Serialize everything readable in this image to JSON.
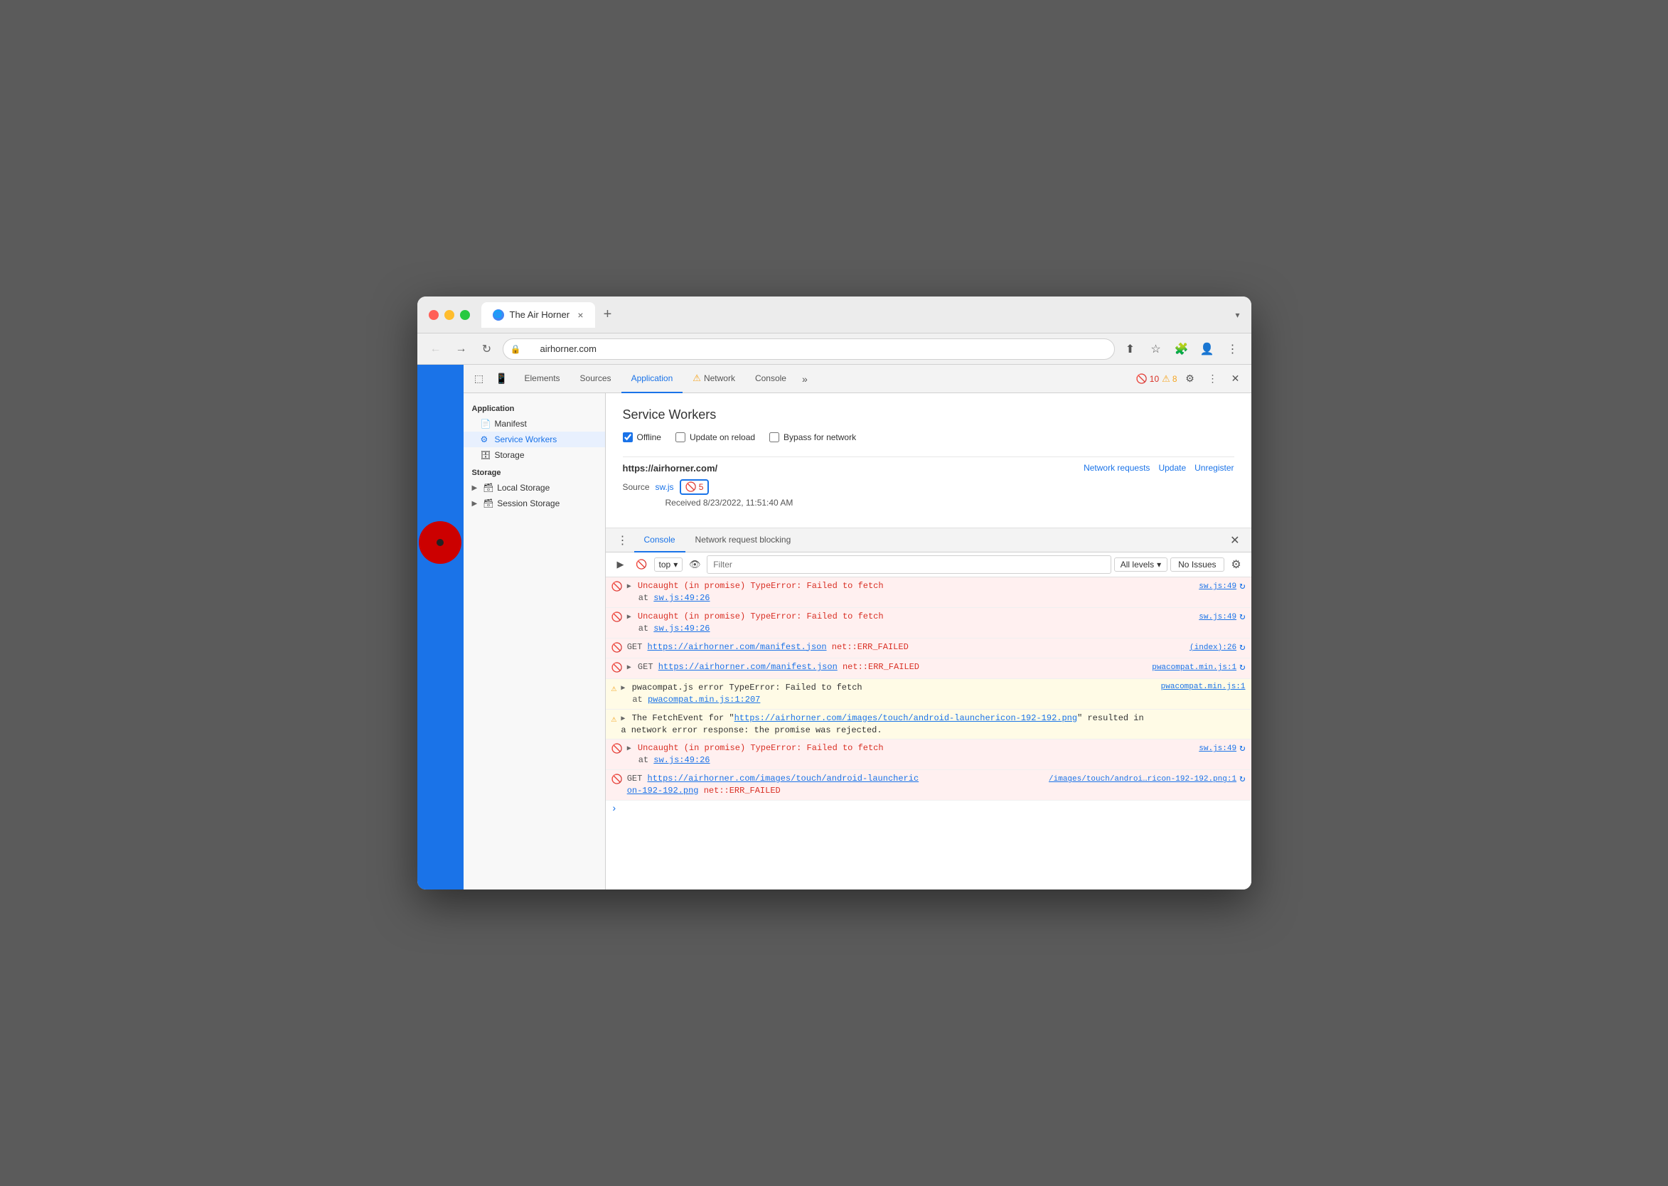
{
  "browser": {
    "tab_title": "The Air Horner",
    "url": "airhorner.com",
    "new_tab_label": "+"
  },
  "address_bar": {
    "back_btn": "←",
    "forward_btn": "→",
    "reload_btn": "↻"
  },
  "devtools": {
    "tabs": [
      {
        "id": "elements",
        "label": "Elements"
      },
      {
        "id": "sources",
        "label": "Sources"
      },
      {
        "id": "application",
        "label": "Application",
        "active": true
      },
      {
        "id": "network",
        "label": "Network",
        "warning": true
      },
      {
        "id": "console",
        "label": "Console"
      }
    ],
    "more_tabs_label": "»",
    "error_count": "10",
    "warn_count": "8"
  },
  "sidebar": {
    "section_application": "Application",
    "manifest": "Manifest",
    "service_workers": "Service Workers",
    "storage": "Storage",
    "section_storage": "Storage",
    "local_storage": "Local Storage",
    "session_storage": "Session Storage"
  },
  "sw_panel": {
    "title": "Service Workers",
    "offline_label": "Offline",
    "update_on_reload_label": "Update on reload",
    "bypass_for_network_label": "Bypass for network",
    "entry_url": "https://airhorner.com/",
    "network_requests_label": "Network requests",
    "update_label": "Update",
    "unregister_label": "Unregister",
    "source_label": "Source",
    "source_file": "sw.js",
    "error_count": "5",
    "received_label": "Received 8/23/2022, 11:51:40 AM"
  },
  "console_tabs": {
    "tab1": "Console",
    "tab2": "Network request blocking"
  },
  "console_toolbar": {
    "context": "top",
    "filter_placeholder": "Filter",
    "level": "All levels",
    "no_issues": "No Issues"
  },
  "console_messages": [
    {
      "type": "error",
      "expand": true,
      "main": "Uncaught (in promise) TypeError: Failed to fetch",
      "sub": "at sw.js:49:26",
      "source": "sw.js:49"
    },
    {
      "type": "error",
      "expand": true,
      "main": "Uncaught (in promise) TypeError: Failed to fetch",
      "sub": "at sw.js:49:26",
      "source": "sw.js:49"
    },
    {
      "type": "error",
      "expand": false,
      "main": "GET https://airhorner.com/manifest.json net::ERR_FAILED",
      "sub": "",
      "source": "(index):26"
    },
    {
      "type": "error",
      "expand": true,
      "main": "GET https://airhorner.com/manifest.json net::ERR_FAILED",
      "sub": "",
      "source": "pwacompat.min.js:1"
    },
    {
      "type": "warning",
      "expand": true,
      "main": "pwacompat.js error TypeError: Failed to fetch",
      "sub": "at pwacompat.min.js:1:207",
      "source": "pwacompat.min.js:1"
    },
    {
      "type": "warning",
      "expand": true,
      "main": "The FetchEvent for \"https://airhorner.com/images/touch/android-launchericon-192-192.png\" resulted in a network error response: the promise was rejected.",
      "sub": "",
      "source": ""
    },
    {
      "type": "error",
      "expand": true,
      "main": "Uncaught (in promise) TypeError: Failed to fetch",
      "sub": "at sw.js:49:26",
      "source": "sw.js:49"
    },
    {
      "type": "error",
      "expand": false,
      "main": "GET https://airhorner.com/images/touch/android-launcheric on-192-192.png net::ERR_FAILED",
      "sub": "",
      "source": "/images/touch/androi…ricon-192-192.png:1"
    }
  ]
}
